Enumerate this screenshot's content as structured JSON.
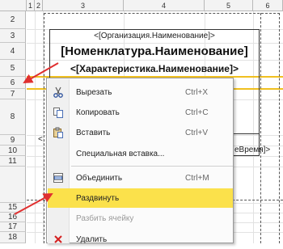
{
  "columns": [
    "1",
    "2",
    "3",
    "4",
    "5",
    "6"
  ],
  "rows": [
    "2",
    "3",
    "4",
    "5",
    "6",
    "7",
    "8",
    "9",
    "10",
    "11",
    "15",
    "16",
    "17",
    "18"
  ],
  "cells": {
    "org_name": "<[Организация.Наименование]>",
    "nomenclature": "[Номенклатура.Наименование]",
    "characteristic": "<[Характеристика.Наименование]>",
    "row9_left_fragment": "<",
    "row9_right_fragment": "еВремя]>"
  },
  "context_menu": {
    "items": [
      {
        "label": "Вырезать",
        "shortcut": "Ctrl+X",
        "icon": "scissors-icon"
      },
      {
        "label": "Копировать",
        "shortcut": "Ctrl+C",
        "icon": "copy-icon"
      },
      {
        "label": "Вставить",
        "shortcut": "Ctrl+V",
        "icon": "paste-icon"
      },
      {
        "label": "Специальная вставка...",
        "shortcut": "",
        "icon": ""
      },
      {
        "label": "Объединить",
        "shortcut": "Ctrl+M",
        "icon": "merge-cells-icon"
      },
      {
        "label": "Раздвинуть",
        "shortcut": "",
        "icon": ""
      },
      {
        "label": "Разбить ячейку",
        "shortcut": "",
        "icon": ""
      },
      {
        "label": "Удалить",
        "shortcut": "",
        "icon": "delete-icon"
      }
    ]
  },
  "colors": {
    "highlight": "#fbe14b",
    "selected_row_line": "#f0c020",
    "arrow": "#e03030",
    "delete_icon": "#d42020"
  }
}
